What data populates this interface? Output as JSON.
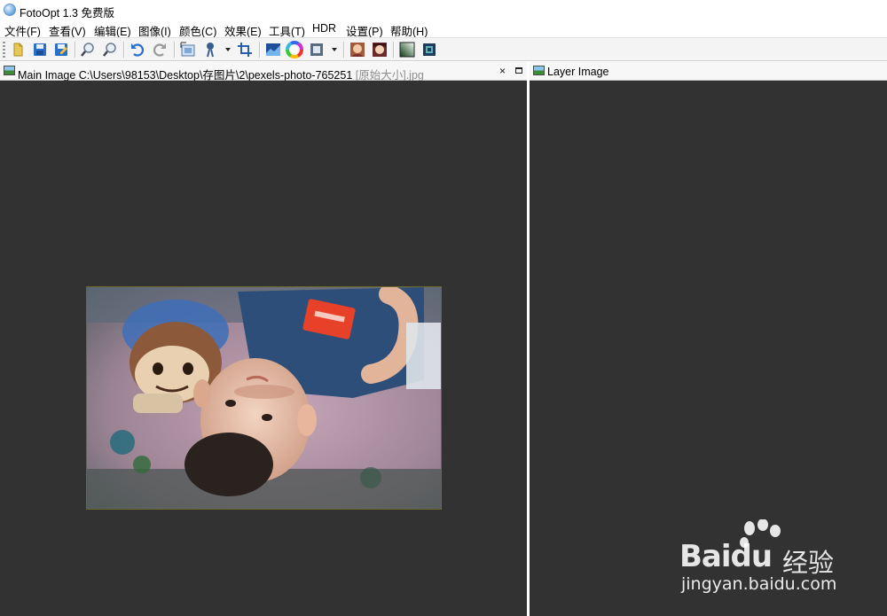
{
  "window": {
    "title": "FotoOpt 1.3 免费版",
    "app_icon": "fotoopt-logo-icon"
  },
  "menu": [
    {
      "label": "文件(F)"
    },
    {
      "label": "查看(V)"
    },
    {
      "label": "编辑(E)"
    },
    {
      "label": "图像(I)"
    },
    {
      "label": "颜色(C)"
    },
    {
      "label": "效果(E)"
    },
    {
      "label": "工具(T)"
    },
    {
      "label": "HDR"
    },
    {
      "label": "设置(P)"
    },
    {
      "label": "帮助(H)"
    }
  ],
  "toolbar": {
    "icons": [
      "open-icon",
      "save-icon",
      "save-as-icon",
      "zoom-in-icon",
      "zoom-out-icon",
      "undo-icon",
      "redo-icon",
      "resize-icon",
      "effects-brush-icon",
      "crop-icon",
      "levels-icon",
      "color-wheel-icon",
      "frame-icon",
      "portrait-icon",
      "beauty-icon",
      "gradient-icon",
      "hdr-icon"
    ]
  },
  "main_pane": {
    "title_prefix": "Main Image C:\\Users\\98153\\Desktop\\存图片\\2\\pexels-photo-765251",
    "title_suffix": " [原始大小].jpg",
    "close_glyph": "×",
    "icon": "image-icon"
  },
  "layer_pane": {
    "title": "Layer Image",
    "icon": "image-icon"
  },
  "colors": {
    "canvas": "#323232",
    "accent": "#e8412a"
  },
  "watermark": {
    "brand": "Bai",
    "brand2": "du",
    "cn": "经验",
    "url": "jingyan.baidu.com"
  }
}
